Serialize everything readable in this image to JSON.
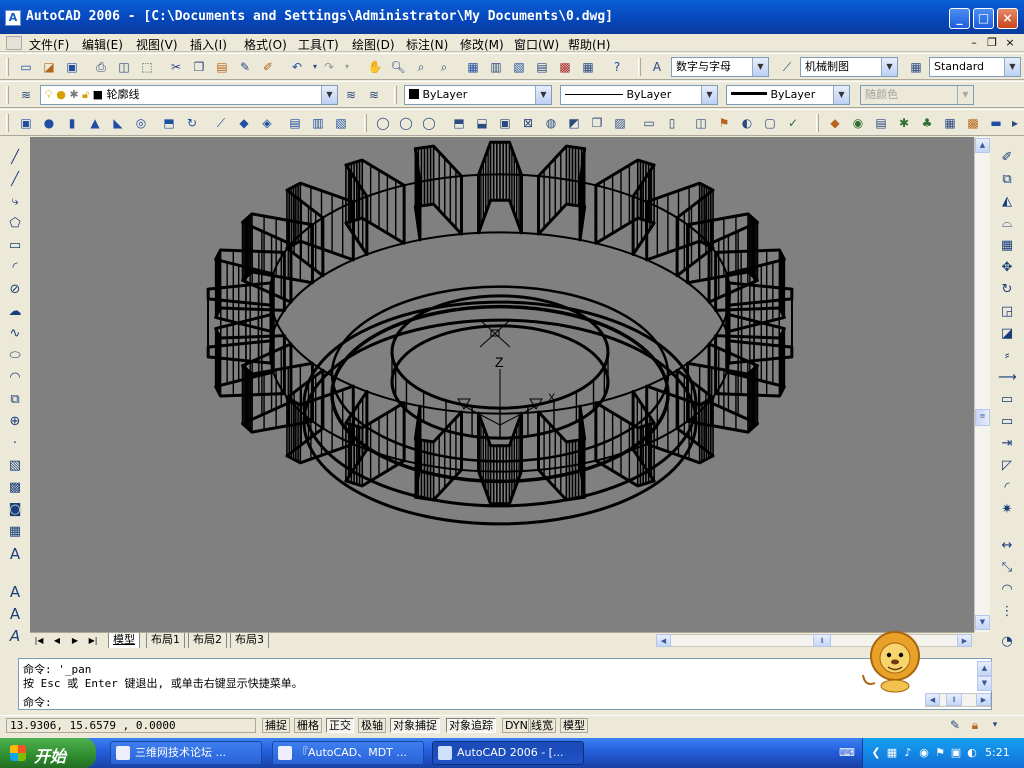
{
  "window": {
    "app_icon": "A",
    "title": "AutoCAD 2006 - [C:\\Documents and Settings\\Administrator\\My Documents\\0.dwg]",
    "minimize": "_",
    "maximize": "□",
    "close": "×"
  },
  "menu": {
    "items": [
      "文件(F)",
      "编辑(E)",
      "视图(V)",
      "插入(I)",
      "格式(O)",
      "工具(T)",
      "绘图(D)",
      "标注(N)",
      "修改(M)",
      "窗口(W)",
      "帮助(H)"
    ],
    "mdi_minimize": "–",
    "mdi_restore": "❐",
    "mdi_close": "×"
  },
  "toolbar_standard": {
    "text_style": "数字与字母",
    "dim_style": "机械制图",
    "table_style": "Standard"
  },
  "toolbar_layers": {
    "layer": "■ 轮廓线",
    "color": "ByLayer",
    "linetype": "ByLayer",
    "lineweight": "ByLayer",
    "plotstyle": "随颜色"
  },
  "drawing": {
    "axis_z": "Z",
    "axis_x": "X"
  },
  "layout_tabs": {
    "tabs": [
      "模型",
      "布局1",
      "布局2",
      "布局3"
    ]
  },
  "command": {
    "line1": "命令: '_pan",
    "line2": "按 Esc 或 Enter 键退出, 或单击右键显示快捷菜单。",
    "prompt": "命令:"
  },
  "status": {
    "coords": "13.9306, 15.6579 , 0.0000",
    "buttons": [
      "捕捉",
      "栅格",
      "正交",
      "极轴",
      "对象捕捉",
      "对象追踪",
      "DYN",
      "线宽",
      "模型"
    ]
  },
  "taskbar": {
    "start": "开始",
    "tasks": [
      "三维网技术论坛 ...",
      "『AutoCAD、MDT ...",
      "AutoCAD 2006 - [..."
    ],
    "clock": "5:21"
  },
  "icons": {
    "mascot": "lion-mascot-icon"
  },
  "colors": {
    "canvas_bg": "#808080",
    "drawing_lines": "#000000",
    "titlebar": "#0a5fd8",
    "taskbar": "#245edb",
    "start_button": "#2e8c2e"
  }
}
